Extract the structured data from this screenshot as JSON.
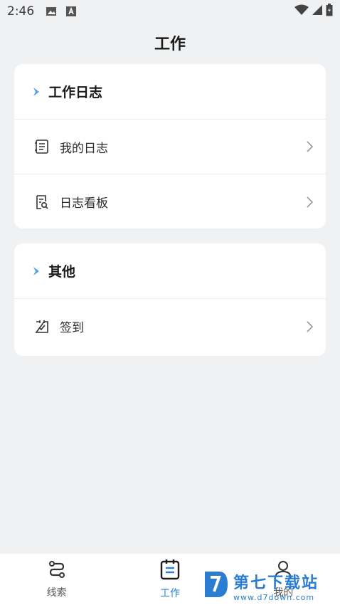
{
  "status_bar": {
    "time": "2:46",
    "icons": [
      "image-icon",
      "a-icon",
      "wifi-icon",
      "signal-icon",
      "battery-icon"
    ]
  },
  "header": {
    "title": "工作"
  },
  "sections": [
    {
      "title": "工作日志",
      "items": [
        {
          "label": "我的日志",
          "icon": "notebook-icon"
        },
        {
          "label": "日志看板",
          "icon": "document-search-icon"
        }
      ]
    },
    {
      "title": "其他",
      "items": [
        {
          "label": "签到",
          "icon": "checkin-icon"
        }
      ]
    }
  ],
  "bottom_nav": {
    "items": [
      {
        "label": "线索",
        "icon": "route-icon",
        "active": false
      },
      {
        "label": "工作",
        "icon": "clipboard-icon",
        "active": true
      },
      {
        "label": "我的",
        "icon": "person-icon",
        "active": false
      }
    ],
    "active_color": "#2d7ee6"
  },
  "watermark": {
    "title": "第七下载站",
    "url": "www.d7down.com"
  },
  "colors": {
    "background": "#f0f1f3",
    "card": "#ffffff",
    "accent": "#2d7ee6",
    "marker": "#4fa3e8"
  }
}
